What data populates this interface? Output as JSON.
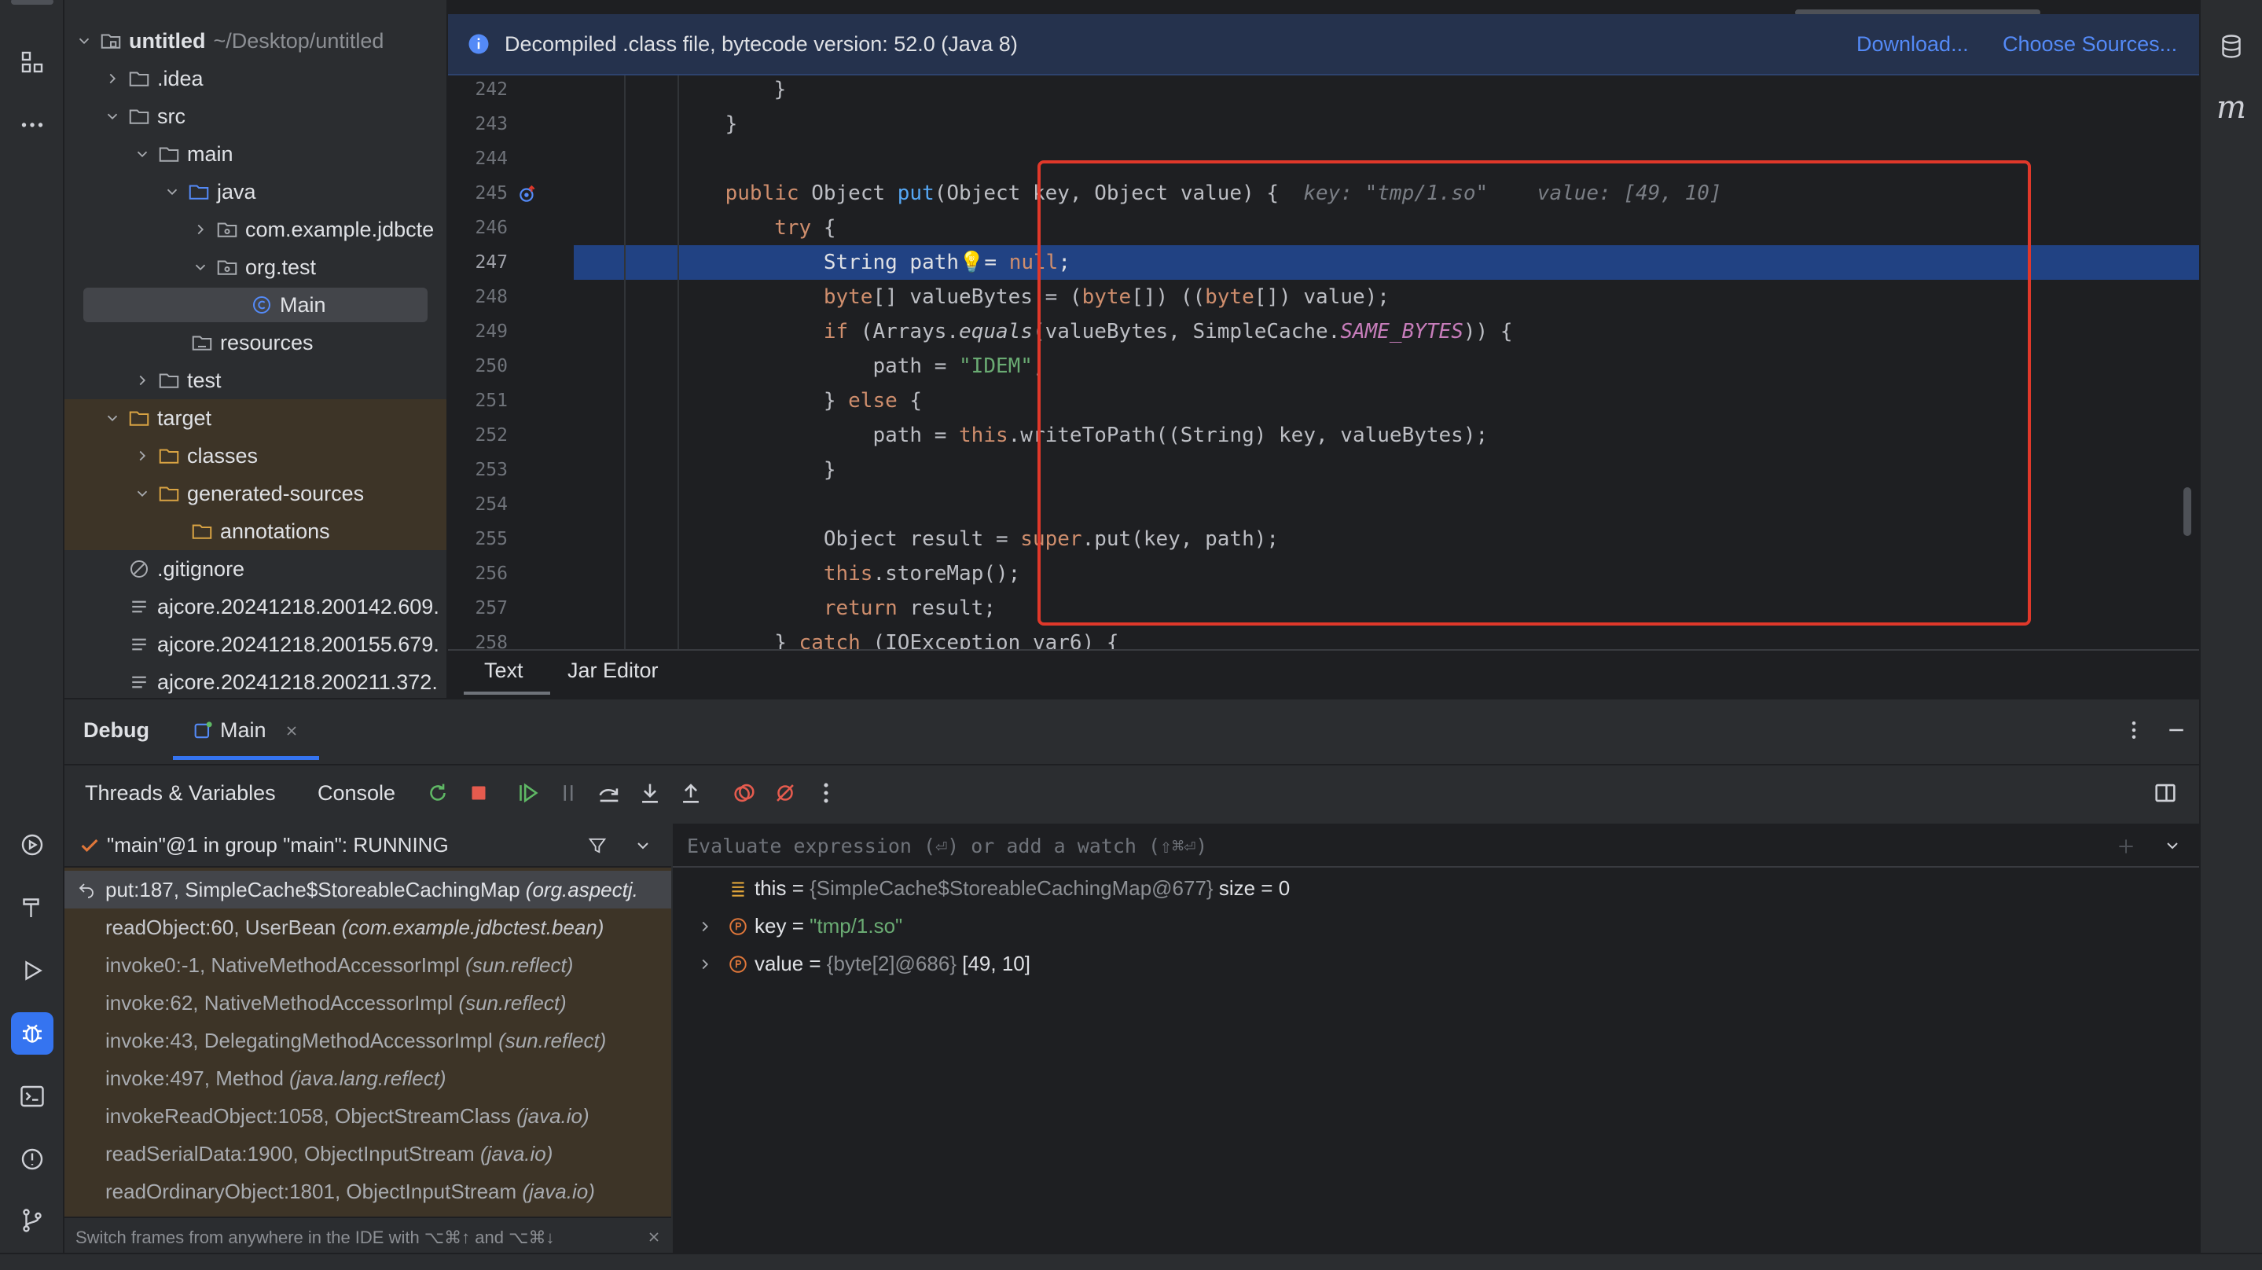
{
  "project_tree": {
    "rows": [
      {
        "label": "untitled",
        "path": "~/Desktop/untitled"
      },
      {
        "label": ".idea"
      },
      {
        "label": "src"
      },
      {
        "label": "main"
      },
      {
        "label": "java"
      },
      {
        "label": "com.example.jdbcte"
      },
      {
        "label": "org.test"
      },
      {
        "label": "Main"
      },
      {
        "label": "resources"
      },
      {
        "label": "test"
      },
      {
        "label": "target"
      },
      {
        "label": "classes"
      },
      {
        "label": "generated-sources"
      },
      {
        "label": "annotations"
      },
      {
        "label": ".gitignore"
      },
      {
        "label": "ajcore.20241218.200142.609."
      },
      {
        "label": "ajcore.20241218.200155.679."
      },
      {
        "label": "ajcore.20241218.200211.372."
      }
    ]
  },
  "editor": {
    "banner": {
      "message": "Decompiled .class file, bytecode version: 52.0 (Java 8)",
      "download": "Download...",
      "choose_sources": "Choose Sources..."
    },
    "line_numbers": [
      "242",
      "243",
      "244",
      "245",
      "246",
      "247",
      "248",
      "249",
      "250",
      "251",
      "252",
      "253",
      "254",
      "255",
      "256",
      "257",
      "258"
    ],
    "current_line": "247",
    "hints": {
      "key": "key: \"tmp/1.so\"",
      "value": "value: [49, 10]"
    },
    "tabs": [
      "Text",
      "Jar Editor"
    ]
  },
  "debug": {
    "title": "Debug",
    "session_tab": "Main",
    "toolbar": {
      "threads_variables": "Threads & Variables",
      "console": "Console"
    },
    "thread": "\"main\"@1 in group \"main\": RUNNING",
    "frames": [
      {
        "name": "put:187, SimpleCache$StoreableCachingMap",
        "pkg": "(org.aspectj."
      },
      {
        "name": "readObject:60, UserBean",
        "pkg": "(com.example.jdbctest.bean)"
      },
      {
        "name": "invoke0:-1, NativeMethodAccessorImpl",
        "pkg": "(sun.reflect)"
      },
      {
        "name": "invoke:62, NativeMethodAccessorImpl",
        "pkg": "(sun.reflect)"
      },
      {
        "name": "invoke:43, DelegatingMethodAccessorImpl",
        "pkg": "(sun.reflect)"
      },
      {
        "name": "invoke:497, Method",
        "pkg": "(java.lang.reflect)"
      },
      {
        "name": "invokeReadObject:1058, ObjectStreamClass",
        "pkg": "(java.io)"
      },
      {
        "name": "readSerialData:1900, ObjectInputStream",
        "pkg": "(java.io)"
      },
      {
        "name": "readOrdinaryObject:1801, ObjectInputStream",
        "pkg": "(java.io)"
      }
    ],
    "frames_footer": "Switch frames from anywhere in the IDE with ⌥⌘↑ and ⌥⌘↓",
    "eval_placeholder": "Evaluate expression (⏎) or add a watch (⇧⌘⏎)",
    "variables": [
      {
        "name": "this",
        "eq": " = ",
        "type": "{SimpleCache$StoreableCachingMap@677}",
        "value": "size = 0"
      },
      {
        "name": "key",
        "eq": " = ",
        "type": "",
        "value": "\"tmp/1.so\""
      },
      {
        "name": "value",
        "eq": " = ",
        "type": "{byte[2]@686}",
        "value": "[49, 10]"
      }
    ]
  },
  "colors": {
    "accent": "#3574f0",
    "highlight_box": "#e0382a",
    "current_line": "#214283"
  }
}
